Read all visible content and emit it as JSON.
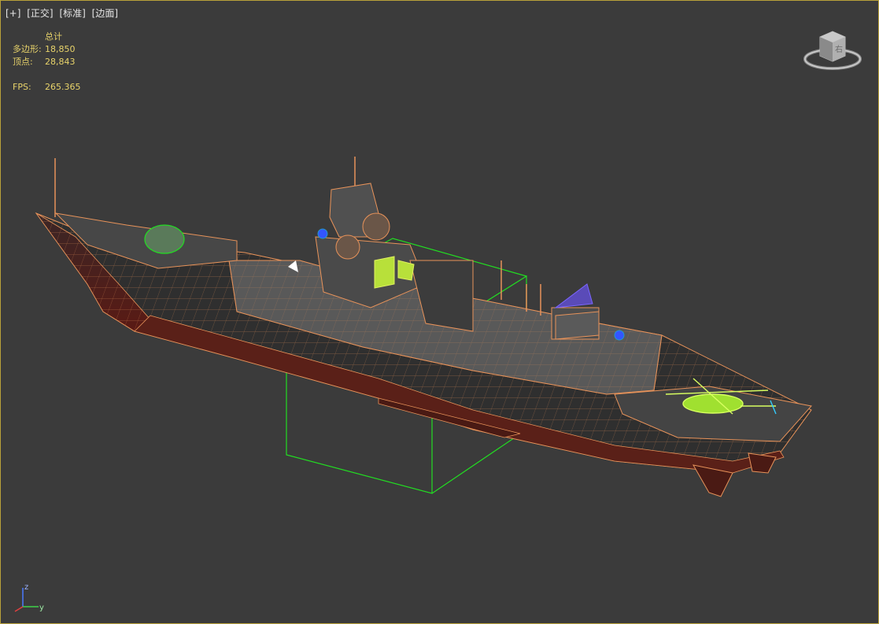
{
  "viewport": {
    "labels": [
      "[+]",
      "[正交]",
      "[标准]",
      "[边面]"
    ]
  },
  "stats": {
    "header": "总计",
    "polygons_label": "多边形:",
    "polygons_value": "18,850",
    "vertices_label": "顶点:",
    "vertices_value": "28,843",
    "fps_label": "FPS:",
    "fps_value": "265.365"
  },
  "viewcube": {
    "face_label": "右"
  },
  "axis_tripod": {
    "z": "z",
    "y": "y"
  },
  "colors": {
    "background": "#3b3b3b",
    "wire_orange": "#e8935a",
    "selection_green": "#22dd22",
    "stats_yellow": "#e8d36a",
    "border": "#b9a13a"
  }
}
